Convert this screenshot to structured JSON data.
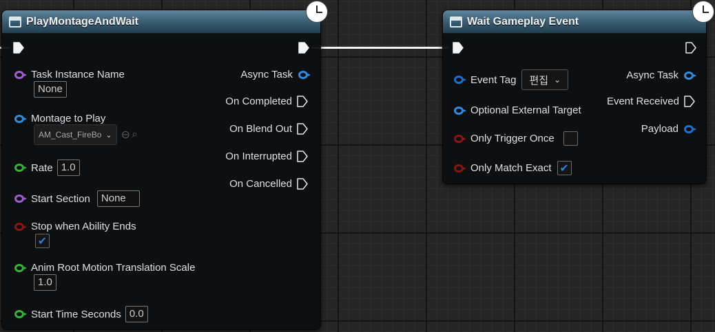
{
  "nodes": {
    "play_montage": {
      "title": "PlayMontageAndWait",
      "inputs": {
        "task_instance_name": {
          "label": "Task Instance Name",
          "value": "None"
        },
        "montage_to_play": {
          "label": "Montage to Play",
          "value": "AM_Cast_FireBo"
        },
        "rate": {
          "label": "Rate",
          "value": "1.0"
        },
        "start_section": {
          "label": "Start Section",
          "value": "None"
        },
        "stop_when_ability_ends": {
          "label": "Stop when Ability Ends",
          "checked": true
        },
        "anim_root_motion": {
          "label": "Anim Root Motion Translation Scale",
          "value": "1.0"
        },
        "start_time_seconds": {
          "label": "Start Time Seconds",
          "value": "0.0"
        }
      },
      "outputs": {
        "async_task": "Async Task",
        "on_completed": "On Completed",
        "on_blend_out": "On Blend Out",
        "on_interrupted": "On Interrupted",
        "on_cancelled": "On Cancelled"
      }
    },
    "wait_gameplay_event": {
      "title": "Wait Gameplay Event",
      "inputs": {
        "event_tag": {
          "label": "Event Tag",
          "dropdown": "편집"
        },
        "optional_external_target": {
          "label": "Optional External Target"
        },
        "only_trigger_once": {
          "label": "Only Trigger Once",
          "checked": false
        },
        "only_match_exact": {
          "label": "Only Match Exact",
          "checked": true
        }
      },
      "outputs": {
        "async_task": "Async Task",
        "event_received": "Event Received",
        "payload": "Payload"
      }
    }
  },
  "glyphs": {
    "check": "✔",
    "chevron": "⌄",
    "back_arrow": "⊖",
    "search": "⌕"
  },
  "colors": {
    "header": "#3d6176",
    "pin_object": "#2f8be0",
    "pin_name": "#9b5fcf",
    "pin_float": "#36b236",
    "pin_bool": "#8b1515",
    "wire": "#f4f4f4"
  }
}
